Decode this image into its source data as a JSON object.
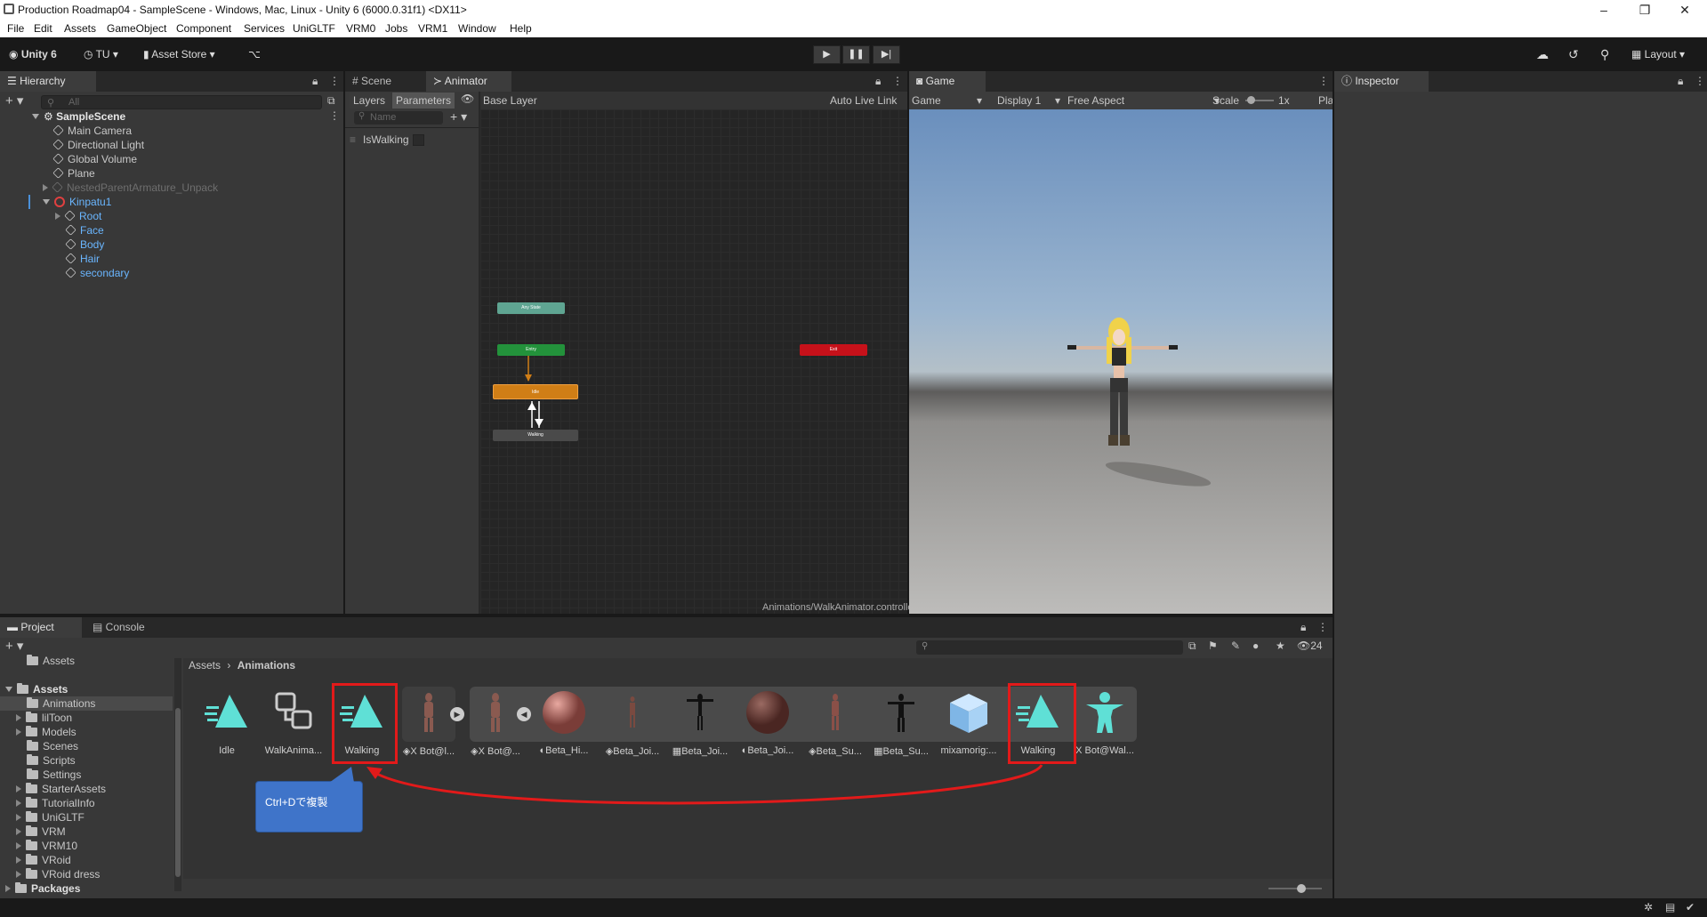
{
  "window": {
    "title": "Production Roadmap04 - SampleScene - Windows, Mac, Linux - Unity 6 (6000.0.31f1) <DX11>"
  },
  "menu": [
    "File",
    "Edit",
    "Assets",
    "GameObject",
    "Component",
    "Services",
    "UniGLTF",
    "VRM0",
    "Jobs",
    "VRM1",
    "Window",
    "Help"
  ],
  "toolbar": {
    "unity": "Unity 6",
    "account": "TU",
    "asset_store": "Asset Store",
    "layout": "Layout"
  },
  "hierarchy": {
    "tab": "Hierarchy",
    "search_placeholder": "All",
    "scene": "SampleScene",
    "items": [
      "Main Camera",
      "Directional Light",
      "Global Volume",
      "Plane",
      "NestedParentArmature_Unpack",
      "Kinpatu1",
      "Root",
      "Face",
      "Body",
      "Hair",
      "secondary"
    ]
  },
  "animator": {
    "tabs": [
      "Scene",
      "Animator"
    ],
    "layers_tab": "Layers",
    "params_tab": "Parameters",
    "name_placeholder": "Name",
    "param": "IsWalking",
    "base_layer": "Base Layer",
    "auto_live": "Auto Live Link",
    "path": "Animations/WalkAnimator.controller",
    "nodes": {
      "any": "Any State",
      "entry": "Entry",
      "exit": "Exit",
      "idle": "Idle",
      "walking": "Walking"
    }
  },
  "game": {
    "tab": "Game",
    "mode": "Game",
    "display": "Display 1",
    "aspect": "Free Aspect",
    "scale_label": "Scale",
    "scale_value": "1x",
    "play": "Pla"
  },
  "inspector": {
    "tab": "Inspector"
  },
  "project": {
    "tabs": [
      "Project",
      "Console"
    ],
    "tree": [
      "Assets",
      "Assets",
      "Animations",
      "lilToon",
      "Models",
      "Scenes",
      "Scripts",
      "Settings",
      "StarterAssets",
      "TutorialInfo",
      "UniGLTF",
      "VRM",
      "VRM10",
      "VRoid",
      "VRoid dress",
      "Packages"
    ],
    "breadcrumb": [
      "Assets",
      "Animations"
    ],
    "count": "24",
    "assets": [
      "Idle",
      "WalkAnima...",
      "Walking",
      "X Bot@l...",
      "X Bot@...",
      "Beta_Hi...",
      "Beta_Joi...",
      "Beta_Joi...",
      "Beta_Joi...",
      "Beta_Su...",
      "Beta_Su...",
      "mixamorig:...",
      "Walking",
      "X Bot@Wal..."
    ]
  },
  "callout": "Ctrl+Dで複製",
  "colors": {
    "highlight": "#e21a1a",
    "callout": "#3f74c9",
    "anim_icon": "#5fe0d6"
  }
}
